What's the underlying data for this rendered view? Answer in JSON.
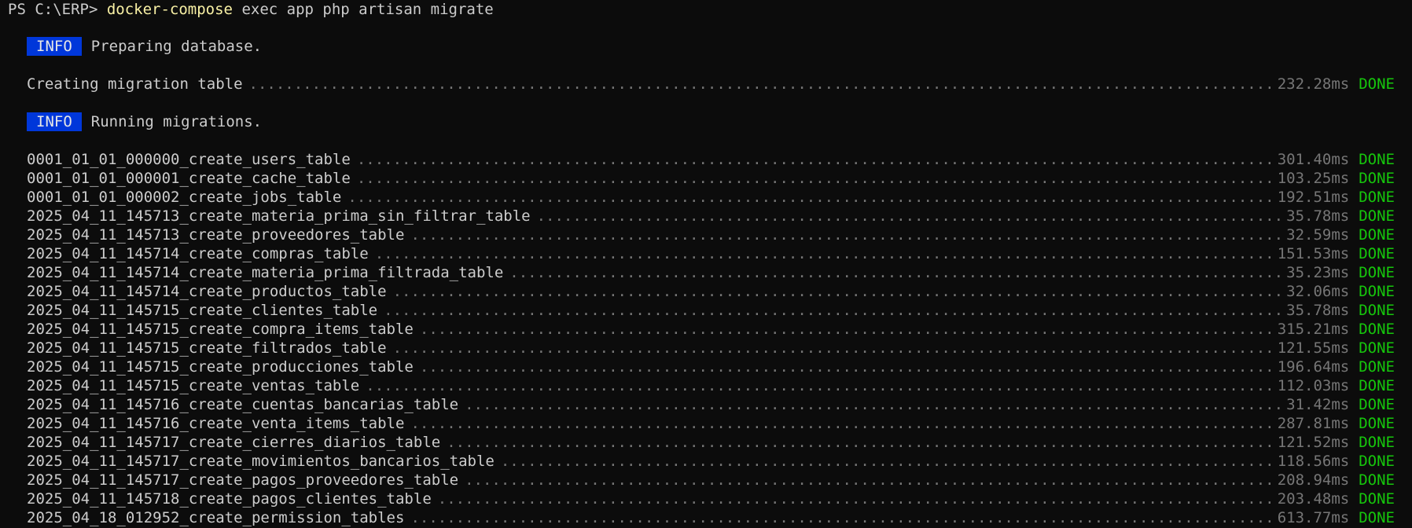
{
  "prompt": {
    "prefix": "PS C:\\ERP> ",
    "bin": "docker-compose",
    "args": " exec app php artisan migrate"
  },
  "info1": {
    "badge": "INFO",
    "text": "Preparing database."
  },
  "creating": {
    "name": "Creating migration table",
    "time": "232.28ms",
    "status": "DONE"
  },
  "info2": {
    "badge": "INFO",
    "text": "Running migrations."
  },
  "migrations": [
    {
      "name": "0001_01_01_000000_create_users_table",
      "time": "301.40ms",
      "status": "DONE"
    },
    {
      "name": "0001_01_01_000001_create_cache_table",
      "time": "103.25ms",
      "status": "DONE"
    },
    {
      "name": "0001_01_01_000002_create_jobs_table",
      "time": "192.51ms",
      "status": "DONE"
    },
    {
      "name": "2025_04_11_145713_create_materia_prima_sin_filtrar_table",
      "time": "35.78ms",
      "status": "DONE"
    },
    {
      "name": "2025_04_11_145713_create_proveedores_table",
      "time": "32.59ms",
      "status": "DONE"
    },
    {
      "name": "2025_04_11_145714_create_compras_table",
      "time": "151.53ms",
      "status": "DONE"
    },
    {
      "name": "2025_04_11_145714_create_materia_prima_filtrada_table",
      "time": "35.23ms",
      "status": "DONE"
    },
    {
      "name": "2025_04_11_145714_create_productos_table",
      "time": "32.06ms",
      "status": "DONE"
    },
    {
      "name": "2025_04_11_145715_create_clientes_table",
      "time": "35.78ms",
      "status": "DONE"
    },
    {
      "name": "2025_04_11_145715_create_compra_items_table",
      "time": "315.21ms",
      "status": "DONE"
    },
    {
      "name": "2025_04_11_145715_create_filtrados_table",
      "time": "121.55ms",
      "status": "DONE"
    },
    {
      "name": "2025_04_11_145715_create_producciones_table",
      "time": "196.64ms",
      "status": "DONE"
    },
    {
      "name": "2025_04_11_145715_create_ventas_table",
      "time": "112.03ms",
      "status": "DONE"
    },
    {
      "name": "2025_04_11_145716_create_cuentas_bancarias_table",
      "time": "31.42ms",
      "status": "DONE"
    },
    {
      "name": "2025_04_11_145716_create_venta_items_table",
      "time": "287.81ms",
      "status": "DONE"
    },
    {
      "name": "2025_04_11_145717_create_cierres_diarios_table",
      "time": "121.52ms",
      "status": "DONE"
    },
    {
      "name": "2025_04_11_145717_create_movimientos_bancarios_table",
      "time": "118.56ms",
      "status": "DONE"
    },
    {
      "name": "2025_04_11_145717_create_pagos_proveedores_table",
      "time": "208.94ms",
      "status": "DONE"
    },
    {
      "name": "2025_04_11_145718_create_pagos_clientes_table",
      "time": "203.48ms",
      "status": "DONE"
    },
    {
      "name": "2025_04_18_012952_create_permission_tables",
      "time": "613.77ms",
      "status": "DONE"
    }
  ]
}
